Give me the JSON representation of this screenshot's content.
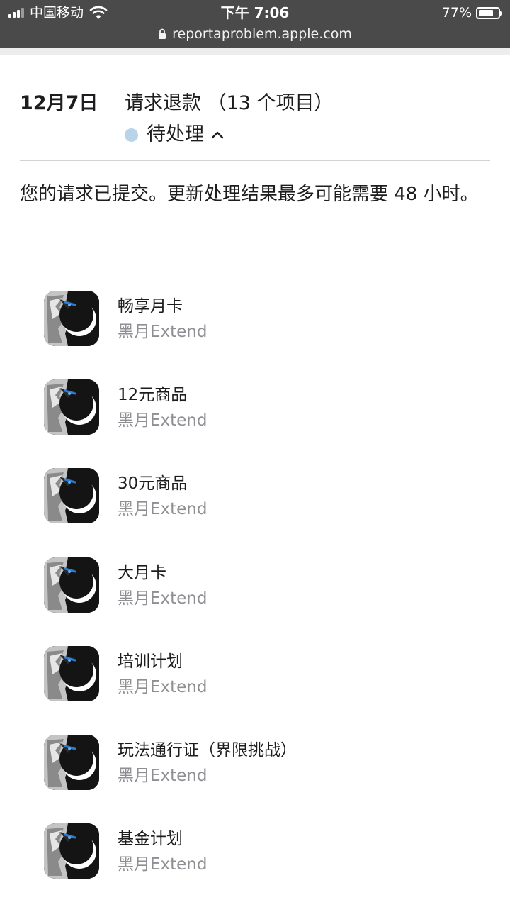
{
  "status_bar": {
    "carrier": "中国移动",
    "time": "下午 7:06",
    "battery": "77%",
    "battery_level": 0.77
  },
  "browser": {
    "url": "reportaproblem.apple.com"
  },
  "request": {
    "date": "12月7日",
    "title": "请求退款 （13 个项目）",
    "status": "待处理",
    "status_color": "#b9d3e9",
    "notice": "您的请求已提交。更新处理结果最多可能需要 48 小时。"
  },
  "items": [
    {
      "name": "畅享月卡",
      "app": "黑月Extend"
    },
    {
      "name": "12元商品",
      "app": "黑月Extend"
    },
    {
      "name": "30元商品",
      "app": "黑月Extend"
    },
    {
      "name": "大月卡",
      "app": "黑月Extend"
    },
    {
      "name": "培训计划",
      "app": "黑月Extend"
    },
    {
      "name": "玩法通行证（界限挑战）",
      "app": "黑月Extend"
    },
    {
      "name": "基金计划",
      "app": "黑月Extend"
    }
  ]
}
